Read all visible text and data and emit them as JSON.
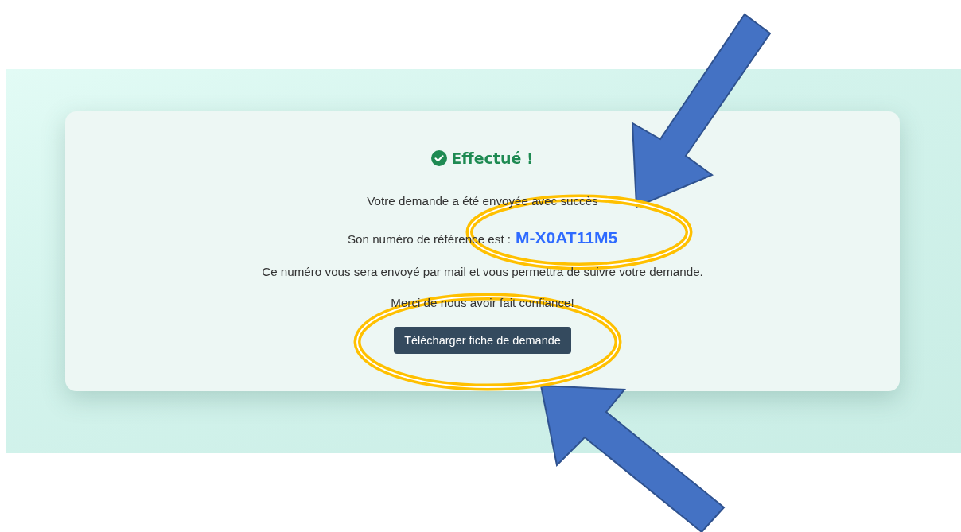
{
  "status": {
    "title": "Effectué !"
  },
  "message": "Votre demande a été envoyée avec succès",
  "reference": {
    "label": "Son numéro de référence est :",
    "number": "M-X0AT11M5"
  },
  "info": "Ce numéro vous sera envoyé par mail et vous permettra de suivre votre demande.",
  "thanks": "Merci de nous avoir fait confiance!",
  "download_button": {
    "label": "Télécharger fiche de demande"
  }
}
